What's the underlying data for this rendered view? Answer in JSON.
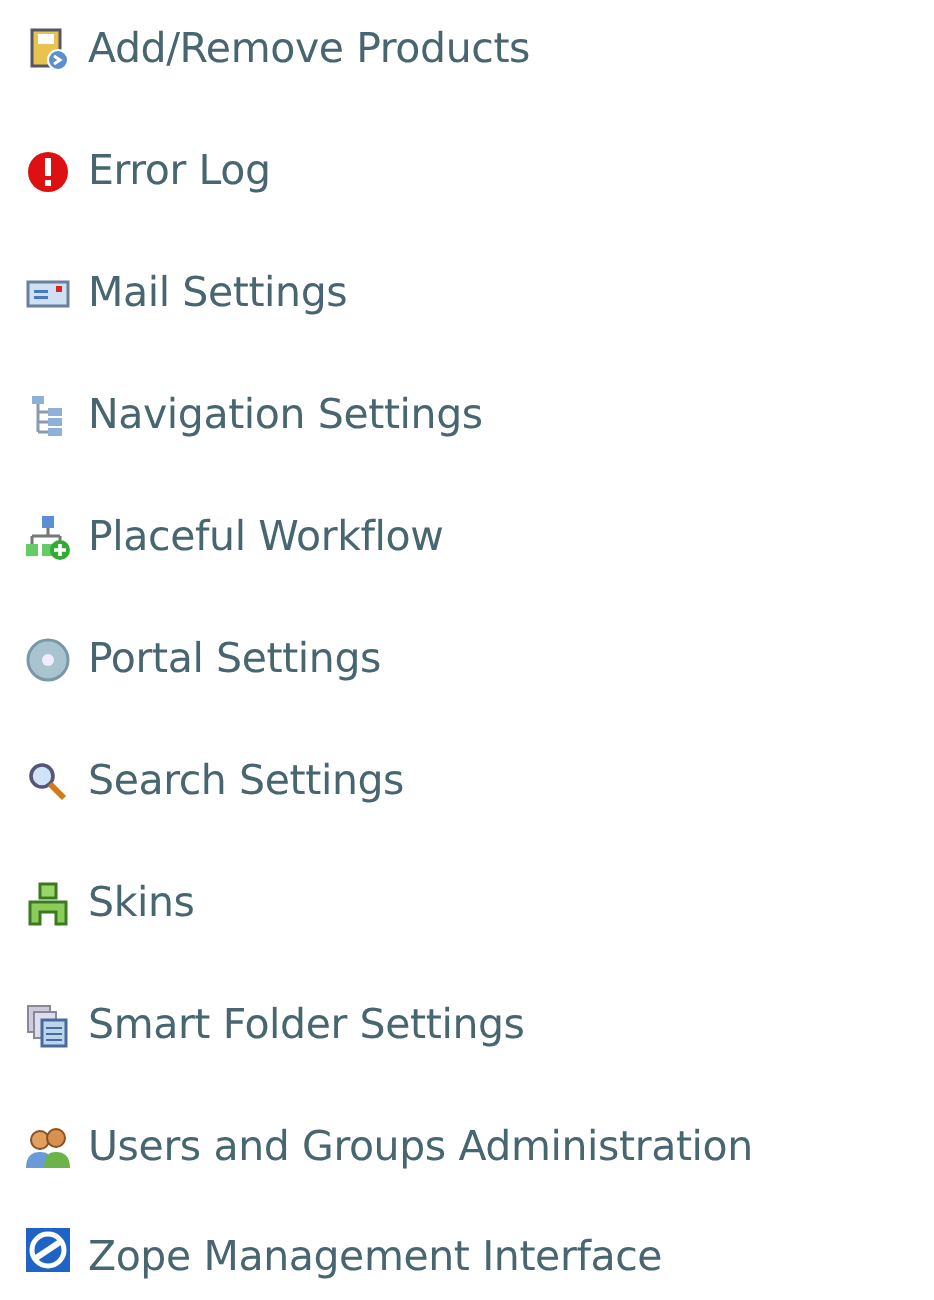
{
  "items": [
    {
      "label": "Add/Remove Products"
    },
    {
      "label": "Error Log"
    },
    {
      "label": "Mail Settings"
    },
    {
      "label": "Navigation Settings"
    },
    {
      "label": "Placeful Workflow"
    },
    {
      "label": "Portal Settings"
    },
    {
      "label": "Search Settings"
    },
    {
      "label": "Skins"
    },
    {
      "label": "Smart Folder Settings"
    },
    {
      "label": "Users and Groups Administration"
    },
    {
      "label": "Zope Management Interface"
    }
  ]
}
